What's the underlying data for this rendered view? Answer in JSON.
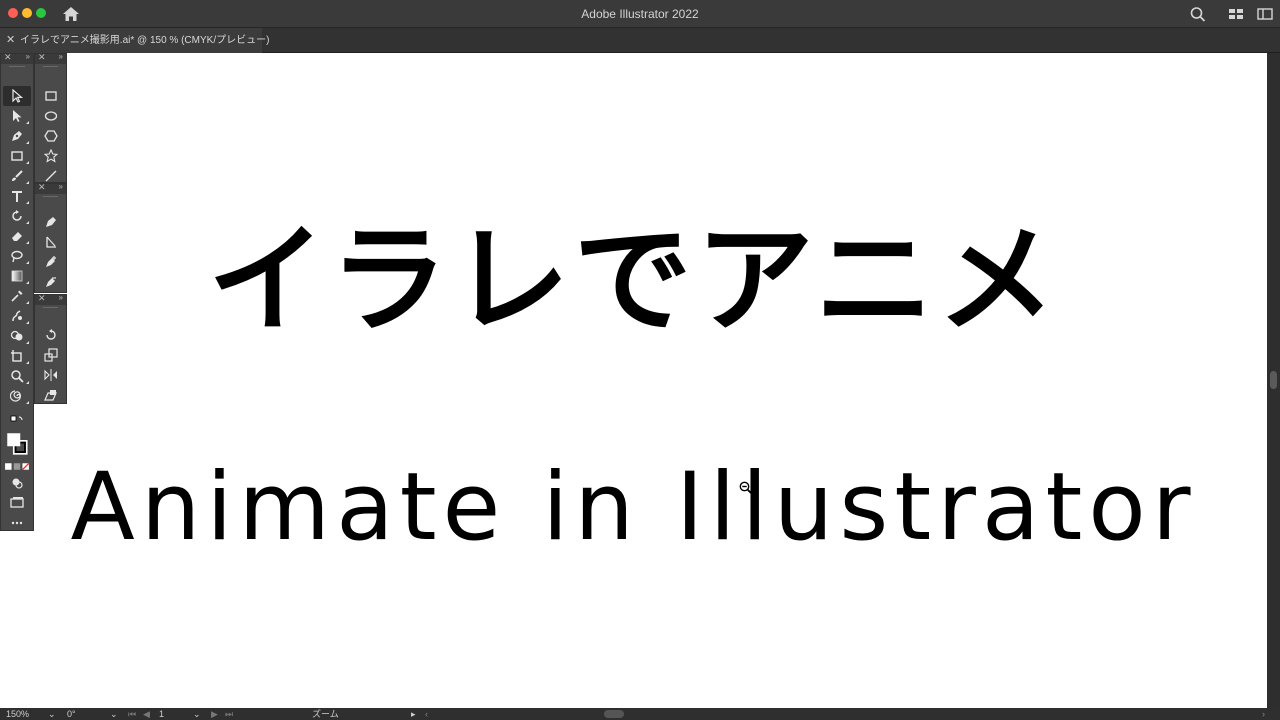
{
  "app": {
    "title": "Adobe Illustrator 2022"
  },
  "document_tab": {
    "label": "イラレでアニメ撮影用.ai* @ 150 % (CMYK/プレビュー)"
  },
  "artboard": {
    "headline_jp": "イラレでアニメ",
    "headline_en": "Animate in Illustrator"
  },
  "status": {
    "zoom": "150%",
    "rotation": "0°",
    "artboard_number": "1",
    "tool_name": "ズーム"
  },
  "icons": {
    "home": "home-icon",
    "search": "search-icon",
    "arrange_documents": "arrange-documents-icon",
    "panels": "panels-icon"
  },
  "colors": {
    "window_chrome": "#3a3a3a",
    "canvas": "#ffffff",
    "panel": "#4a4a4a",
    "text": "#000000"
  }
}
